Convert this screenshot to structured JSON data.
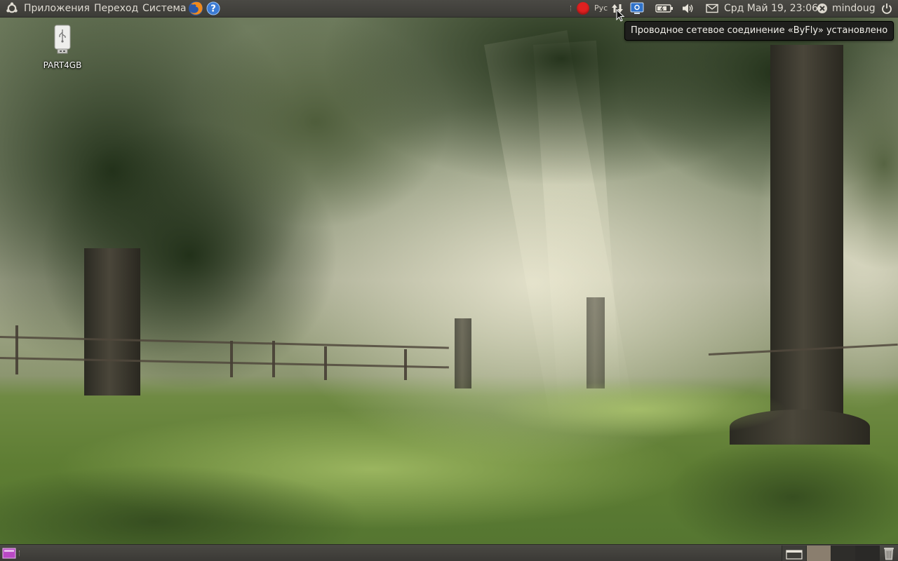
{
  "top_panel": {
    "menus": [
      "Приложения",
      "Переход",
      "Система"
    ],
    "keyboard_layout": "Рус",
    "clock": "Срд Май 19, 23:06",
    "username": "mindoug"
  },
  "tooltip": {
    "text": "Проводное сетевое соединение «ByFly» установлено"
  },
  "desktop": {
    "icons": [
      {
        "label": "PART4GB",
        "icon": "usb-drive-icon"
      }
    ]
  },
  "colors": {
    "panel": "#3c3b37",
    "panel_text": "#dfdbd2",
    "tooltip_bg": "#1e1e1c",
    "record_red": "#e02020",
    "workspace_active": "#8a7e6e"
  }
}
